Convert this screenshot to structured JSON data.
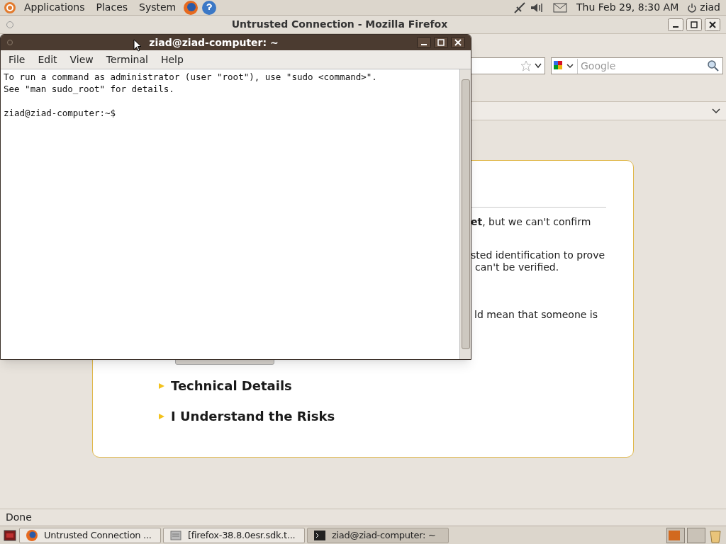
{
  "top_panel": {
    "menus": [
      "Applications",
      "Places",
      "System"
    ],
    "clock": "Thu Feb 29,  8:30 AM",
    "user": "ziad"
  },
  "firefox": {
    "title": "Untrusted Connection - Mozilla Firefox",
    "search": {
      "placeholder": "Google"
    },
    "content": {
      "paragraphs": [
        "**et**, but we can't confirm",
        "sted identification to prove",
        "can't be verified.",
        "ld mean that someone is"
      ],
      "sections": [
        "Technical Details",
        "I Understand the Risks"
      ]
    },
    "status": "Done"
  },
  "terminal": {
    "title": "ziad@ziad-computer: ~",
    "menus": [
      "File",
      "Edit",
      "View",
      "Terminal",
      "Help"
    ],
    "lines": [
      "To run a command as administrator (user \"root\"), use \"sudo <command>\".",
      "See \"man sudo_root\" for details."
    ],
    "prompt": "ziad@ziad-computer:~$"
  },
  "taskbar": [
    {
      "label": "Untrusted Connection ...",
      "kind": "browser",
      "selected": false
    },
    {
      "label": "[firefox-38.8.0esr.sdk.t...",
      "kind": "archive",
      "selected": false
    },
    {
      "label": "ziad@ziad-computer: ~",
      "kind": "terminal",
      "selected": true
    }
  ]
}
